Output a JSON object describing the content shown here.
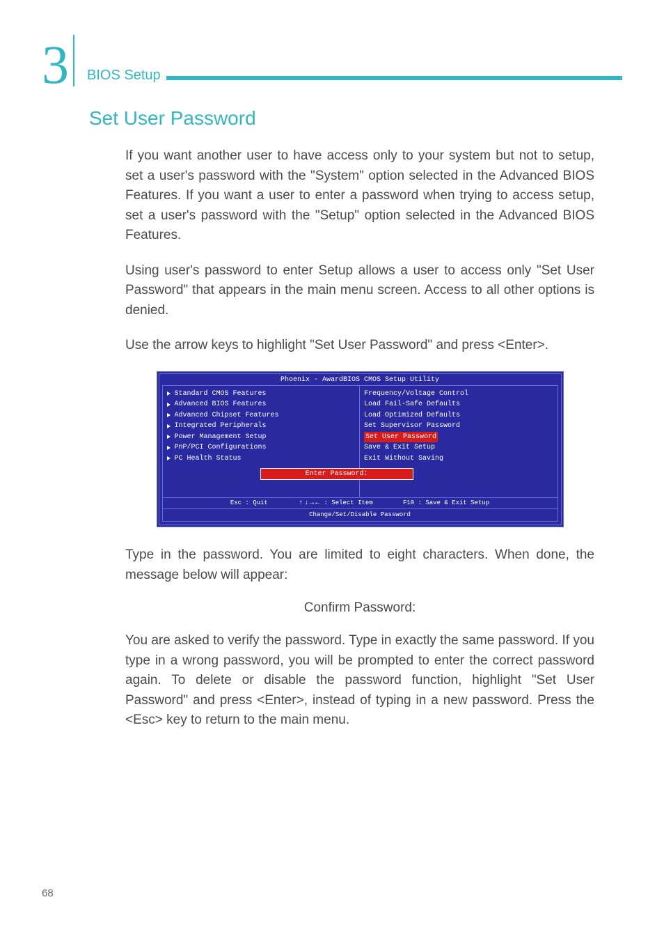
{
  "header": {
    "chapter_number": "3",
    "chapter_label": "BIOS Setup"
  },
  "section_title": "Set User Password",
  "paragraphs": {
    "p1": "If you want another user to have access only to your system but not to setup, set a user's password with the \"System\" option selected in the Advanced BIOS Features. If you want a user to enter a password when trying to access setup, set a user's password with the \"Setup\" option selected in the Advanced BIOS Features.",
    "p2": "Using user's password to enter Setup allows a user to access only \"Set User Password\" that appears in the main menu screen. Access to all other options is denied.",
    "p3": "Use the arrow keys to highlight \"Set User Password\" and press <Enter>.",
    "p4": "Type in the password. You are limited to eight characters. When done, the message below will appear:",
    "confirm": "Confirm Password:",
    "p5": "You are asked to verify the password. Type in exactly the same password. If you type in a wrong password, you will be prompted to enter the correct password again. To delete or disable the password function, highlight \"Set User Password\" and press <Enter>, instead of typing in a new password. Press the <Esc> key to return to the main menu."
  },
  "bios": {
    "title": "Phoenix - AwardBIOS CMOS Setup Utility",
    "left_items": [
      "Standard CMOS Features",
      "Advanced BIOS Features",
      "Advanced Chipset Features",
      "Integrated Peripherals",
      "Power Management Setup",
      "PnP/PCI Configurations",
      "PC Health Status"
    ],
    "right_items": [
      "Frequency/Voltage Control",
      "Load Fail-Safe Defaults",
      "Load Optimized Defaults",
      "Set Supervisor Password",
      "Set User Password",
      "Save & Exit Setup",
      "Exit Without Saving"
    ],
    "highlighted_right_index": 4,
    "dialog_label": "Enter Password:",
    "help": {
      "esc": "Esc : Quit",
      "save": "F10 : Save & Exit Setup",
      "arrows_label": " : Select Item"
    },
    "footer": "Change/Set/Disable Password"
  },
  "page_number": "68"
}
